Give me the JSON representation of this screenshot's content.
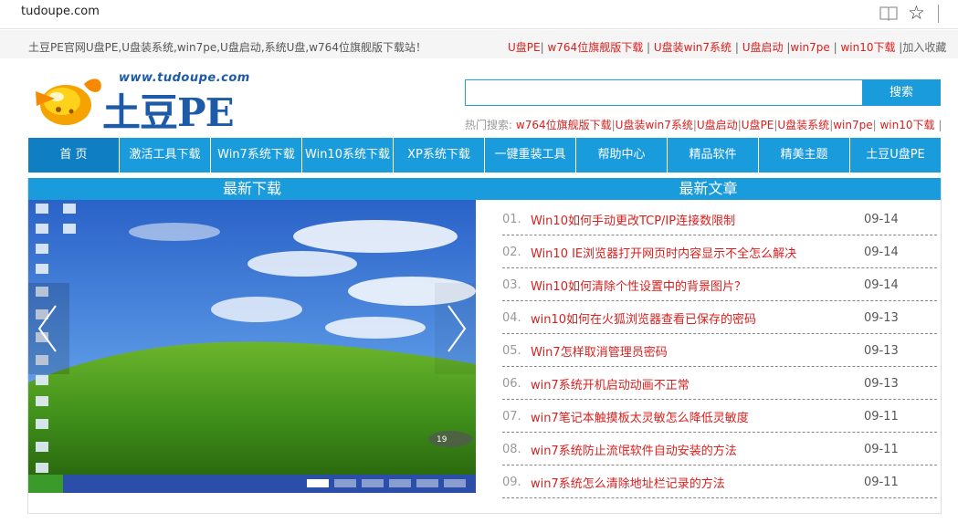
{
  "browser": {
    "url": "tudoupe.com"
  },
  "topbar": {
    "slogan": "土豆PE官网U盘PE,U盘装系统,win7pe,U盘启动,系统U盘,w764位旗舰版下载站！",
    "links": [
      "U盘PE",
      "w764位旗舰版下载",
      "U盘装win7系统",
      "U盘启动",
      "win7pe",
      "win10下载"
    ],
    "favorite": "加入收藏"
  },
  "logo": {
    "url_text": "www.tudoupe.com",
    "text": "土豆PE"
  },
  "search": {
    "placeholder": "",
    "button": "搜索",
    "hot_label": "热门搜索:",
    "hot_links": [
      "w764位旗舰版下载",
      "U盘装win7系统",
      "U盘启动",
      "U盘PE",
      "U盘装系统",
      "win7pe",
      "win10下载"
    ]
  },
  "nav": {
    "items": [
      "首 页",
      "激活工具下载",
      "Win7系统下载",
      "Win10系统下载",
      "XP系统下载",
      "一键重装工具",
      "帮助中心",
      "精品软件",
      "精美主题",
      "土豆U盘PE"
    ]
  },
  "sections": {
    "downloads_title": "最新下载",
    "articles_title": "最新文章"
  },
  "slider": {
    "badge": "19"
  },
  "articles": [
    {
      "no": "01.",
      "title": "Win10如何手动更改TCP/IP连接数限制",
      "date": "09-14"
    },
    {
      "no": "02.",
      "title": "Win10 IE浏览器打开网页时内容显示不全怎么解决",
      "date": "09-14"
    },
    {
      "no": "03.",
      "title": "Win10如何清除个性设置中的背景图片？",
      "date": "09-14"
    },
    {
      "no": "04.",
      "title": "win10如何在火狐浏览器查看已保存的密码",
      "date": "09-13"
    },
    {
      "no": "05.",
      "title": "Win7怎样取消管理员密码",
      "date": "09-13"
    },
    {
      "no": "06.",
      "title": "win7系统开机启动动画不正常",
      "date": "09-13"
    },
    {
      "no": "07.",
      "title": "win7笔记本触摸板太灵敏怎么降低灵敏度",
      "date": "09-11"
    },
    {
      "no": "08.",
      "title": "win7系统防止流氓软件自动安装的方法",
      "date": "09-11"
    },
    {
      "no": "09.",
      "title": "win7系统怎么清除地址栏记录的方法",
      "date": "09-11"
    }
  ]
}
